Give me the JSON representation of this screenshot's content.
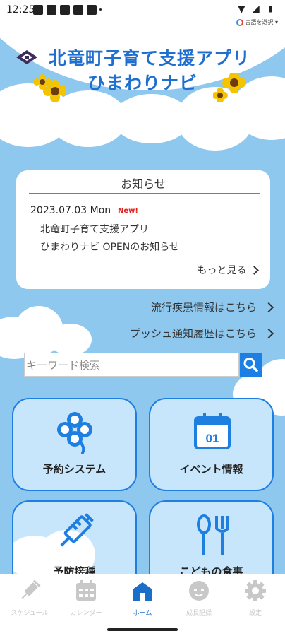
{
  "status_bar": {
    "time": "12:25"
  },
  "translate": {
    "label": "言語を選択"
  },
  "header": {
    "line1": "北竜町子育て支援アプリ",
    "line2": "ひまわりナビ"
  },
  "news": {
    "title": "お知らせ",
    "date": "2023.07.03 Mon",
    "new_badge": "New!",
    "line1": "北竜町子育て支援アプリ",
    "line2": "ひまわりナビ OPENのお知らせ",
    "more": "もっと見る"
  },
  "links": {
    "disease": "流行疾患情報はこちら",
    "push": "プッシュ通知履歴はこちら"
  },
  "search": {
    "placeholder": "キーワード検索"
  },
  "tiles": [
    {
      "label": "予約システム",
      "icon": "clover-icon"
    },
    {
      "label": "イベント情報",
      "icon": "calendar-icon"
    },
    {
      "label": "予防接種",
      "icon": "syringe-icon"
    },
    {
      "label": "こどもの食事",
      "icon": "spoon-fork-icon"
    }
  ],
  "calendar_tile_number": "01",
  "tabs": [
    {
      "label": "スケジュール",
      "icon": "syringe-icon"
    },
    {
      "label": "カレンダー",
      "icon": "calendar-icon"
    },
    {
      "label": "ホーム",
      "icon": "home-icon"
    },
    {
      "label": "成長記録",
      "icon": "baby-face-icon"
    },
    {
      "label": "設定",
      "icon": "gear-icon"
    }
  ],
  "colors": {
    "sky": "#8ec8ef",
    "accent": "#1e7fe0",
    "tile_bg": "#c8e6fb",
    "new_red": "#e0201c"
  }
}
